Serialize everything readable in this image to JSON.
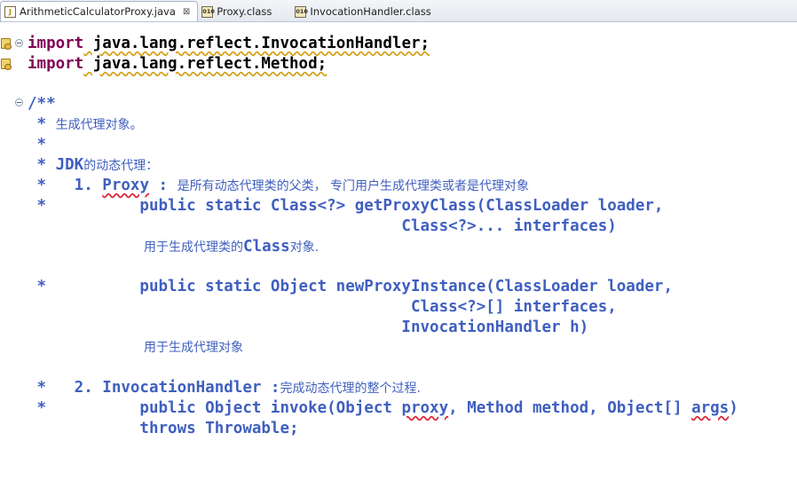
{
  "tabs": [
    {
      "label": "ArithmeticCalculatorProxy.java",
      "close": "⊠"
    },
    {
      "label": "Proxy.class"
    },
    {
      "label": "InvocationHandler.class"
    }
  ],
  "code": {
    "import1_kw": "import",
    "import1_rest": " java.lang.reflect.InvocationHandler;",
    "import2_kw": "import",
    "import2_rest": " java.lang.reflect.Method;",
    "doc_open": "/**",
    "c1_star": " * ",
    "c1_text": "生成代理对象。",
    "c2": " *",
    "c3_star": " * JDK",
    "c3_text": "的动态代理：",
    "c4_prefix": " *   1. ",
    "c4_proxy": "Proxy",
    "c4_colon": " : ",
    "c4_text": "是所有动态代理类的父类， 专门用户生成代理类或者是代理对象",
    "c5": " *          public static Class<?> getProxyClass(ClassLoader loader,",
    "c6": "                                        Class<?>... interfaces)",
    "c7_text1": "用于生成代理类的",
    "c7_class": "Class",
    "c7_text2": "对象.",
    "c8": " *          public static Object newProxyInstance(ClassLoader loader,",
    "c9": "                                         Class<?>[] interfaces,",
    "c10": "                                        InvocationHandler h)",
    "c11_text": "用于生成代理对象",
    "c12_prefix": " *   2. InvocationHandler :",
    "c12_text": "完成动态代理的整个过程.",
    "c13_a": " *          public Object invoke(Object ",
    "c13_proxy": "proxy",
    "c13_b": ", Method method, Object[] ",
    "c13_args": "args",
    "c13_c": ")",
    "c14": "            throws Throwable;"
  }
}
